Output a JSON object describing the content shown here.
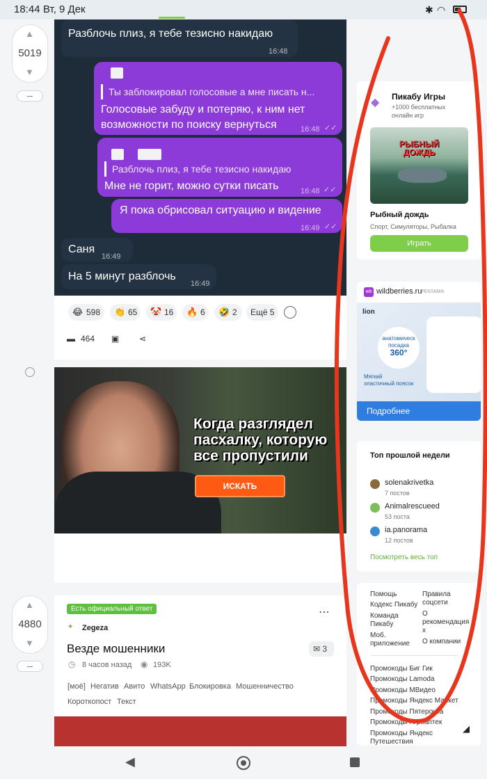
{
  "status": {
    "time": "18:44",
    "date": "Вт, 9 Дек"
  },
  "post1": {
    "rating": "5019",
    "chat": {
      "m1": {
        "text": "Разблочь плиз, я тебе тезисно накидаю",
        "time": "16:48"
      },
      "m2": {
        "quote": "Ты заблокировал голосовые а мне писать н...",
        "line1": "Голосовые забуду и потеряю, к ним нет",
        "line2": "возможности по поиску вернуться",
        "time": "16:48"
      },
      "m3": {
        "quote": "Разблочь плиз, я тебе тезисно накидаю",
        "text": "Мне не горит, можно сутки писать",
        "time": "16:48"
      },
      "m4": {
        "text": "Я пока обрисовал ситуацию и видение",
        "time": "16:49"
      },
      "m5": {
        "text": "Саня",
        "time": "16:49"
      },
      "m6": {
        "text": "На 5 минут разблочь",
        "time": "16:49"
      }
    },
    "reactions": [
      {
        "emoji": "😂",
        "count": "598"
      },
      {
        "emoji": "👏",
        "count": "65"
      },
      {
        "emoji": "🤡",
        "count": "16"
      },
      {
        "emoji": "🔥",
        "count": "6"
      },
      {
        "emoji": "🤣",
        "count": "2"
      }
    ],
    "more_reactions": "Ещё 5",
    "comments": "464"
  },
  "ad": {
    "line1": "Когда разглядел",
    "line2": "пасхалку, которую",
    "line3": "все пропустили",
    "button": "ИСКАТЬ"
  },
  "post2": {
    "rating": "4880",
    "badge": "Есть официальный ответ",
    "author": "Zegeza",
    "title": "Везде мошенники",
    "time": "8 часов назад",
    "views": "193K",
    "comments": "3",
    "tags": [
      "[моё]",
      "Негатив",
      "Авито",
      "WhatsApp",
      "Блокировка",
      "Мошенничество",
      "Короткопост",
      "Текст"
    ]
  },
  "sidebar": {
    "games": {
      "title": "Пикабу Игры",
      "subtitle1": "+1000 бесплатных",
      "subtitle2": "онлайн игр",
      "image_title1": "РЫБНЫЙ",
      "image_title2": "ДОЖДЬ",
      "game_name": "Рыбный дождь",
      "genres": "Спорт, Симуляторы, Рыбалка",
      "play": "Играть"
    },
    "wb": {
      "name": "wildberries.ru",
      "label": "РЕКЛАМА",
      "brand": "lion",
      "badge1": "анатомическ",
      "badge2": "посадка",
      "badge3": "360°",
      "desc1": "Мягкий",
      "desc2": "эластичный поясок",
      "more": "Подробнее"
    },
    "top": {
      "title": "Топ прошлой недели",
      "users": [
        {
          "name": "solenakrivetka",
          "posts": "7 постов"
        },
        {
          "name": "Animalrescueed",
          "posts": "53 поста"
        },
        {
          "name": "ia.panorama",
          "posts": "12 постов"
        }
      ],
      "link": "Посмотреть весь топ"
    },
    "footer": {
      "help": "Помощь",
      "code": "Кодекс Пикабу",
      "team1": "Команда",
      "team2": "Пикабу",
      "mobile1": "Моб.",
      "mobile2": "приложение",
      "rules1": "Правила",
      "rules2": "соцсети",
      "rec1": "О",
      "rec2": "рекомендация",
      "rec3": "х",
      "about": "О компании"
    },
    "promos": [
      "Промокоды Биг Гик",
      "Промокоды Lamoda",
      "Промокоды МВидео",
      "Промокоды Яндекс Маркет",
      "Промокоды Пятерочка",
      "Промокоды Агроаптек",
      "Промокоды Яндекс",
      "Путешествия"
    ]
  },
  "colors": {
    "accent": "#7fce4a",
    "bubble_out": "#8c3ad8",
    "chat_bg": "#1e2b39",
    "annotation": "#e8351e"
  }
}
